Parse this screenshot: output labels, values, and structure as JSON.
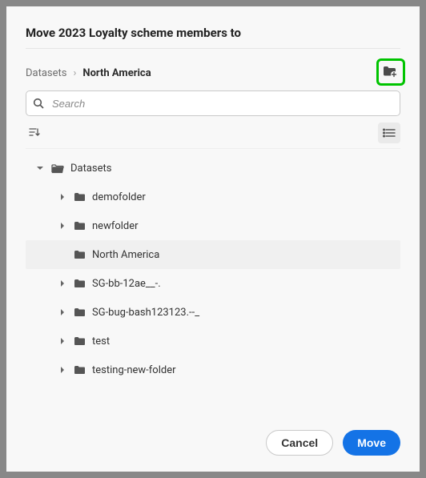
{
  "title": "Move 2023 Loyalty scheme members to",
  "breadcrumb": {
    "root": "Datasets",
    "sep": "›",
    "current": "North America"
  },
  "search": {
    "placeholder": "Search"
  },
  "tree": {
    "root": "Datasets",
    "items": [
      {
        "label": "demofolder"
      },
      {
        "label": "newfolder"
      },
      {
        "label": "North America"
      },
      {
        "label": "SG-bb-12ae__-."
      },
      {
        "label": "SG-bug-bash123123.--_"
      },
      {
        "label": "test"
      },
      {
        "label": "testing-new-folder"
      }
    ]
  },
  "footer": {
    "cancel": "Cancel",
    "move": "Move"
  }
}
